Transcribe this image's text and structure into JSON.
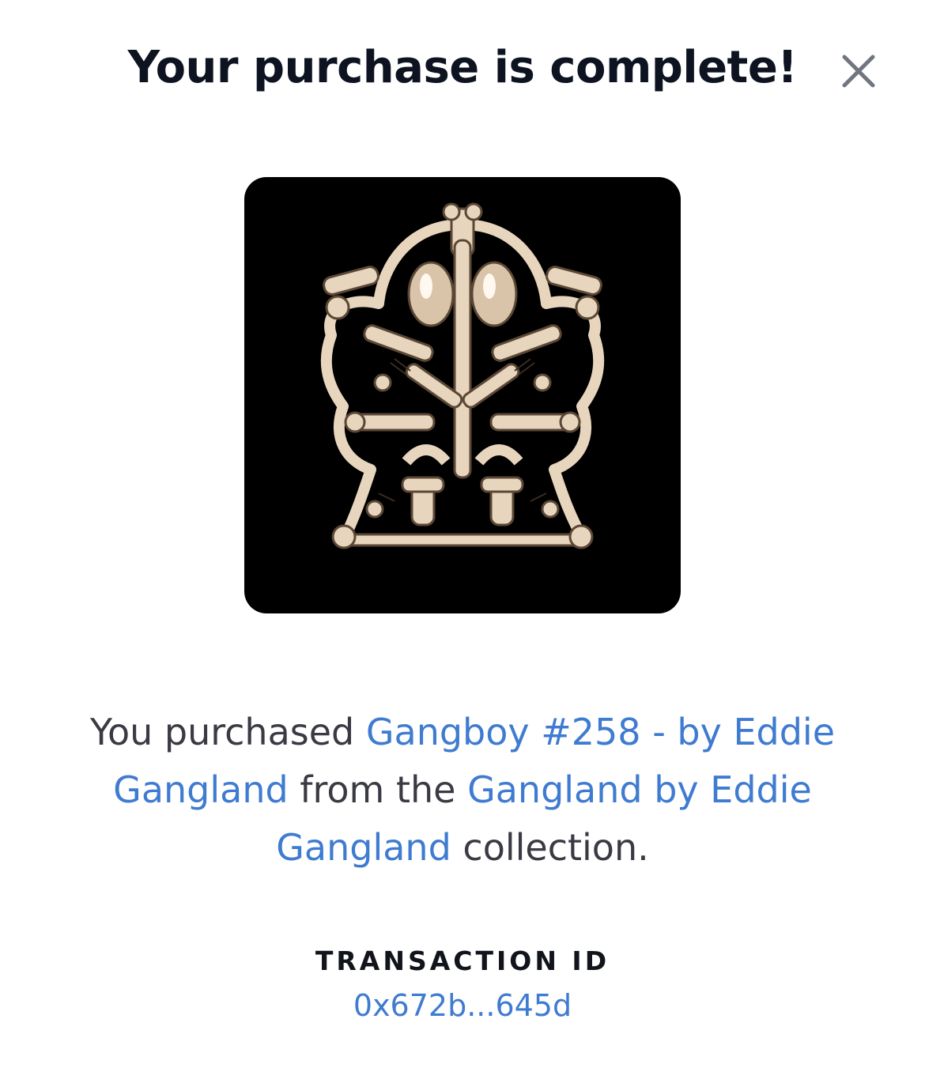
{
  "header": {
    "title": "Your purchase is complete!",
    "close_icon": "close-icon"
  },
  "nft": {
    "image_icon": "bone-skull-artwork"
  },
  "message": {
    "prefix": "You purchased ",
    "item_link": "Gangboy #258 - by Eddie Gangland",
    "middle": " from the ",
    "collection_link": "Gangland by Eddie Gangland",
    "suffix": " collection."
  },
  "transaction": {
    "label": "TRANSACTION ID",
    "id": "0x672b...645d"
  },
  "colors": {
    "title": "#0d1320",
    "link": "#3f7bd0",
    "body_text": "#3a3a44",
    "image_bg": "#000000",
    "bone": "#e8d5bd"
  }
}
